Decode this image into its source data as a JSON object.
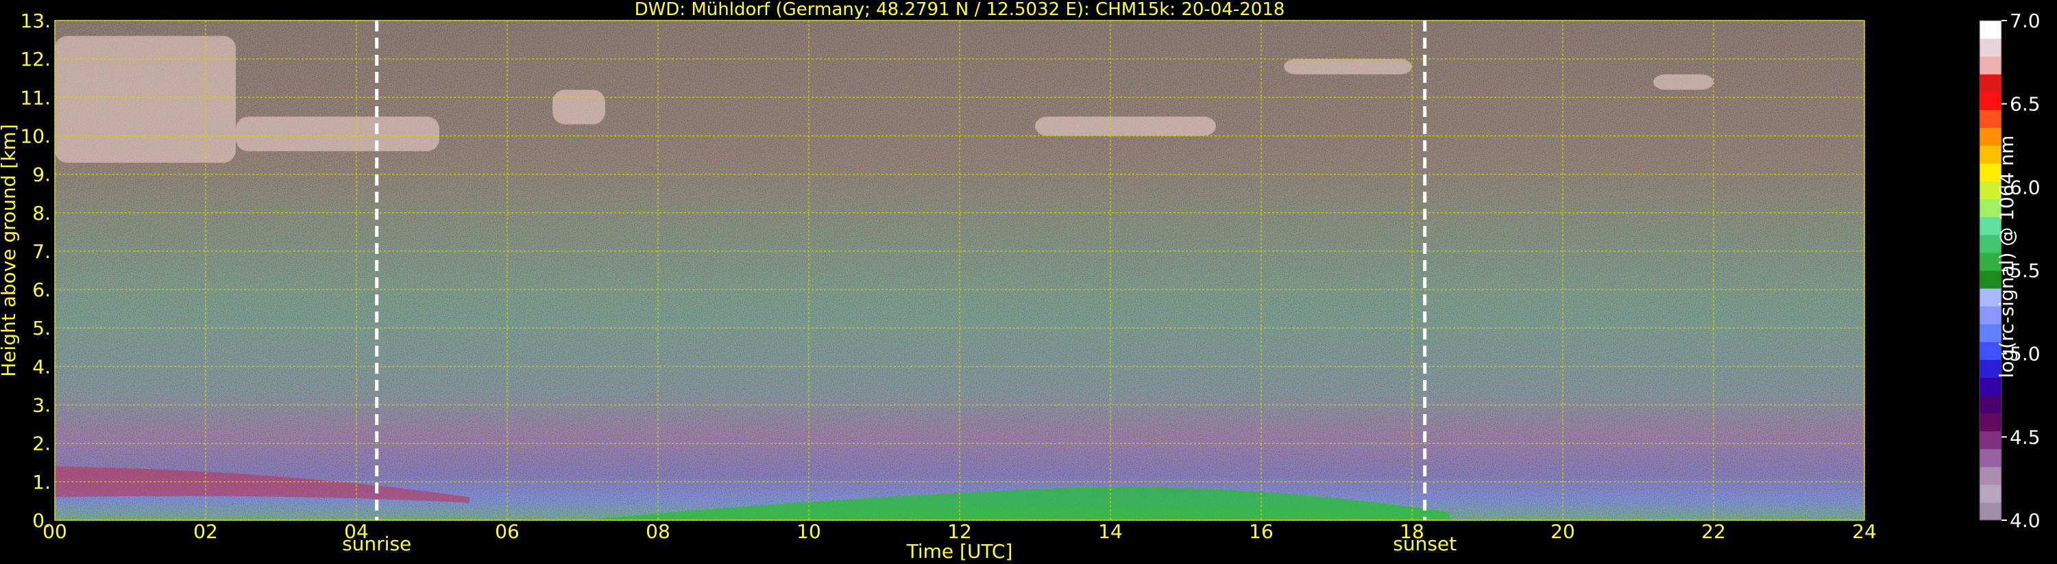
{
  "chart_data": {
    "type": "heatmap",
    "title": "DWD: Mühldorf (Germany; 48.2791 N / 12.5032 E):    CHM15k: 20-04-2018",
    "xlabel": "Time [UTC]",
    "ylabel": "Height above ground [km]",
    "colorbar_label": "log(rc-signal) @ 1064 nm",
    "x_ticks": [
      "00",
      "02",
      "04",
      "06",
      "08",
      "10",
      "12",
      "14",
      "16",
      "18",
      "20",
      "22",
      "24"
    ],
    "y_ticks": [
      "0.",
      "1.",
      "2.",
      "3.",
      "4.",
      "5.",
      "6.",
      "7.",
      "8.",
      "9.",
      "10.",
      "11.",
      "12.",
      "13."
    ],
    "colorbar_ticks": [
      "4.0",
      "4.5",
      "5.0",
      "5.5",
      "6.0",
      "6.5",
      "7.0"
    ],
    "xlim": [
      0,
      24
    ],
    "ylim": [
      0,
      13
    ],
    "zlim": [
      4.0,
      7.0
    ],
    "grid": true,
    "colors": {
      "text": "#ffff33",
      "grid": "#d4d400",
      "markers": "#ffffff"
    },
    "events": [
      {
        "label": "sunrise",
        "time": 4.27
      },
      {
        "label": "sunset",
        "time": 18.17
      }
    ],
    "colorbar_colors": [
      "#a08ea8",
      "#b8a6bf",
      "#ac8cb0",
      "#9a60a4",
      "#80307e",
      "#600a60",
      "#4a0070",
      "#3400a8",
      "#2a20d8",
      "#4050ff",
      "#6080ff",
      "#8898ff",
      "#aab8ff",
      "#1c8c1c",
      "#30b040",
      "#40c870",
      "#60e0a0",
      "#a0f060",
      "#d0f030",
      "#ffee00",
      "#ffc000",
      "#ff9000",
      "#ff5020",
      "#ff1010",
      "#e01818",
      "#f0b0b0",
      "#e8d4d8",
      "#ffffff"
    ]
  }
}
